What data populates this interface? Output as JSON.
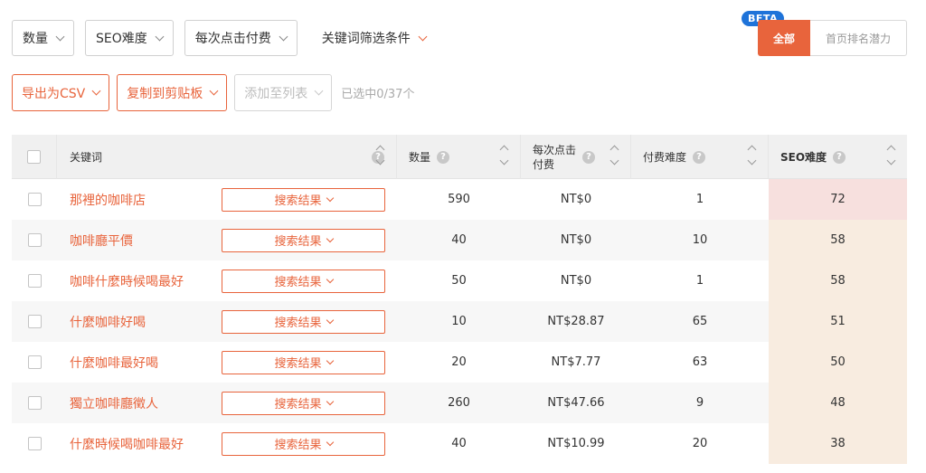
{
  "filters": {
    "volume": "数量",
    "seo_difficulty": "SEO难度",
    "cpc": "每次点击付费",
    "keyword_filters": "关键词筛选条件"
  },
  "segment": {
    "beta": "BETA",
    "all": "全部",
    "potential": "首页排名潜力"
  },
  "actions": {
    "export_csv": "导出为CSV",
    "copy_clipboard": "复制到剪贴板",
    "add_to_list": "添加至列表",
    "selected_count": "已选中0/37个"
  },
  "table": {
    "headers": {
      "keyword": "关键词",
      "volume": "数量",
      "cpc_line1": "每次点击",
      "cpc_line2": "付费",
      "paid_difficulty": "付费难度",
      "seo_difficulty": "SEO难度"
    },
    "serp_label": "搜索结果",
    "rows": [
      {
        "keyword": "那裡的咖啡店",
        "volume": "590",
        "cpc": "NT$0",
        "paid": "1",
        "seo": "72",
        "seo_color": "#f7e0de"
      },
      {
        "keyword": "咖啡廳平價",
        "volume": "40",
        "cpc": "NT$0",
        "paid": "10",
        "seo": "58",
        "seo_color": "#f8ece0"
      },
      {
        "keyword": "咖啡什麼時候喝最好",
        "volume": "50",
        "cpc": "NT$0",
        "paid": "1",
        "seo": "58",
        "seo_color": "#f8ece0"
      },
      {
        "keyword": "什麼咖啡好喝",
        "volume": "10",
        "cpc": "NT$28.87",
        "paid": "65",
        "seo": "51",
        "seo_color": "#f8ece0"
      },
      {
        "keyword": "什麼咖啡最好喝",
        "volume": "20",
        "cpc": "NT$7.77",
        "paid": "63",
        "seo": "50",
        "seo_color": "#f8ece0"
      },
      {
        "keyword": "獨立咖啡廳徵人",
        "volume": "260",
        "cpc": "NT$47.66",
        "paid": "9",
        "seo": "48",
        "seo_color": "#f8ece0"
      },
      {
        "keyword": "什麼時候喝咖啡最好",
        "volume": "40",
        "cpc": "NT$10.99",
        "paid": "20",
        "seo": "38",
        "seo_color": "#f8ece0"
      }
    ]
  },
  "colors": {
    "accent": "#e8643c",
    "beta_badge": "#1e73d9"
  }
}
